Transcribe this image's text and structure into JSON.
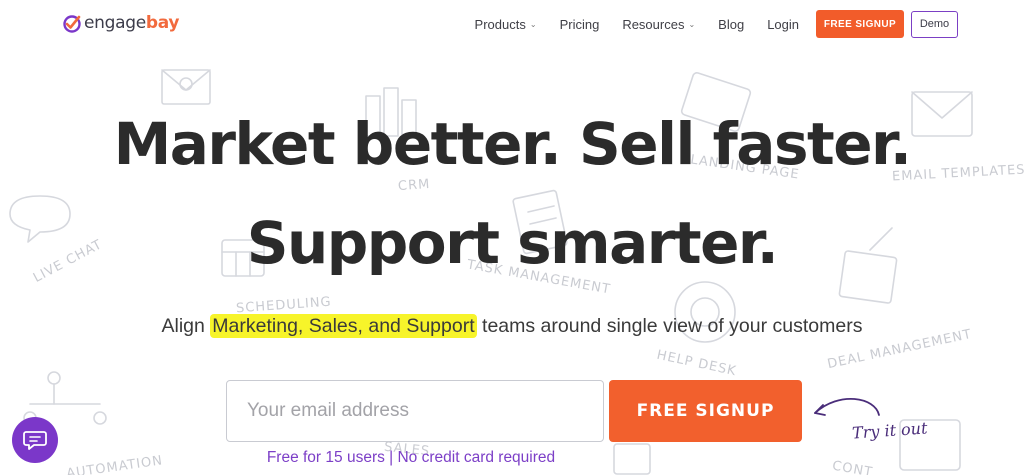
{
  "header": {
    "logo": {
      "word_part1": "engage",
      "word_part2": "bay"
    },
    "nav": [
      {
        "label": "Products",
        "has_dropdown": true
      },
      {
        "label": "Pricing",
        "has_dropdown": false
      },
      {
        "label": "Resources",
        "has_dropdown": true
      },
      {
        "label": "Blog",
        "has_dropdown": false
      },
      {
        "label": "Login",
        "has_dropdown": false
      }
    ],
    "cta_signup": "FREE SIGNUP",
    "cta_demo": "Demo"
  },
  "hero": {
    "headline_line1": "Market better. Sell faster.",
    "headline_line2": "Support smarter.",
    "sub_prefix": "Align ",
    "sub_highlight": "Marketing, Sales, and Support",
    "sub_suffix": " teams around single view of your customers",
    "email_placeholder": "Your email address",
    "email_value": "",
    "signup_button": "FREE SIGNUP",
    "note": "Free for 15 users | No credit card required",
    "try_it_out": "Try it out"
  },
  "background_labels": [
    "LIVE CHAT",
    "CRM",
    "LANDING PAGE",
    "EMAIL TEMPLATES",
    "TASK MANAGEMENT",
    "SCHEDULING",
    "HELP DESK",
    "DEAL MANAGEMENT",
    "AUTOMATION",
    "SALES",
    "CONT"
  ],
  "colors": {
    "brand_orange": "#f2602d",
    "brand_purple": "#7b37c9",
    "highlight_yellow": "#f7f42a",
    "text_dark": "#2b2b2b"
  },
  "icons": {
    "chat_widget": "chat-bubble-icon",
    "logo_mark": "engagebay-logo-icon",
    "try_arrow": "curved-arrow-icon"
  }
}
